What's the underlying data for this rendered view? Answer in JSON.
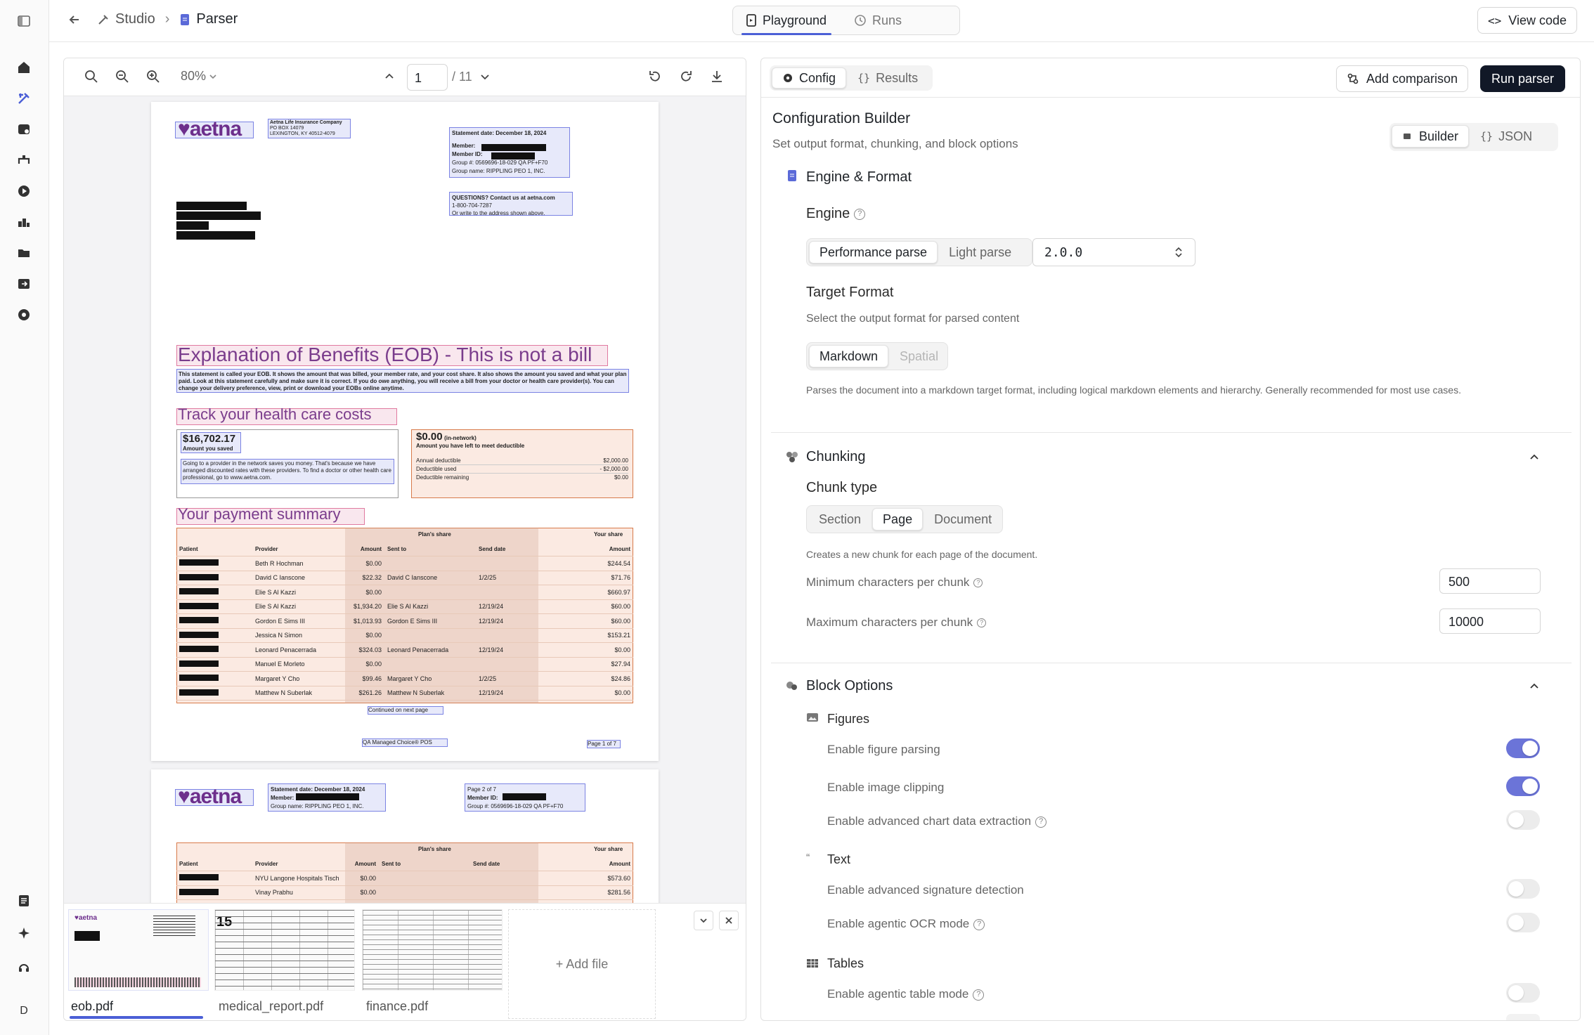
{
  "rail": {
    "avatar": "D"
  },
  "header": {
    "crumb_studio": "Studio",
    "crumb_parser": "Parser",
    "tab_playground": "Playground",
    "tab_runs": "Runs",
    "view_code": "View code"
  },
  "toolbar": {
    "zoom": "80%",
    "page_input": "1",
    "page_total": "/ 11"
  },
  "document": {
    "p1": {
      "logo": "♥aetna",
      "company": [
        "Aetna Life Insurance Company",
        "PO BOX 14079",
        "LEXINGTON, KY 40512-4079"
      ],
      "statement": "Statement date:  December 18, 2024",
      "member": "Member:",
      "member_id": "Member ID:",
      "group_num": "Group #:  0569696-18-029 QA PF+F70",
      "group_name": "Group name:  RIPPLING PEO 1, INC.",
      "questions": [
        "QUESTIONS? Contact us at aetna.com",
        "1-800-704-7287",
        "Or write to the address shown above."
      ],
      "title": "Explanation of Benefits (EOB) - This is not a bill",
      "intro": "This statement is called your EOB. It shows the amount that was billed, your member rate, and your cost share. It also shows the amount you saved and what your plan paid. Look at this statement carefully and make sure it is correct. If you do owe anything, you will receive a bill from your doctor or health care provider(s). You can change your delivery preference, view, print or download your EOBs online anytime.",
      "track": "Track your health care costs",
      "saved_amount": "$16,702.17",
      "saved_label": "Amount you saved",
      "saved_text": "Going to a provider in the network saves you money. That's because we have arranged discounted rates with these providers. To find a doctor or other health care professional, go to www.aetna.com.",
      "deduct_amount": "$0.00",
      "deduct_net": "(in-network)",
      "deduct_label": "Amount you have left to meet deductible",
      "annual_label": "Annual deductible",
      "annual_val": "$2,000.00",
      "used_label": "Deductible used",
      "used_val": "- $2,000.00",
      "remaining_label": "Deductible remaining",
      "remaining_val": "$0.00",
      "summary": "Your payment summary",
      "plans_share": "Plan's share",
      "your_share": "Your share",
      "cols": [
        "Patient",
        "Provider",
        "Amount",
        "Sent to",
        "Send date",
        "Amount"
      ],
      "rows": [
        [
          "Beth R Hochman",
          "$0.00",
          "",
          "",
          "$244.54"
        ],
        [
          "David C Ianscone",
          "$22.32",
          "David C Ianscone",
          "1/2/25",
          "$71.76"
        ],
        [
          "Elie S Al Kazzi",
          "$0.00",
          "",
          "",
          "$660.97"
        ],
        [
          "Elie S Al Kazzi",
          "$1,934.20",
          "Elie S Al Kazzi",
          "12/19/24",
          "$60.00"
        ],
        [
          "Gordon E Sims III",
          "$1,013.93",
          "Gordon E Sims III",
          "12/19/24",
          "$60.00"
        ],
        [
          "Jessica N Simon",
          "$0.00",
          "",
          "",
          "$153.21"
        ],
        [
          "Leonard Penacerrada",
          "$324.03",
          "Leonard Penacerrada",
          "12/19/24",
          "$0.00"
        ],
        [
          "Manuel E Morleto",
          "$0.00",
          "",
          "",
          "$27.94"
        ],
        [
          "Margaret Y Cho",
          "$99.46",
          "Margaret Y Cho",
          "1/2/25",
          "$24.86"
        ],
        [
          "Matthew N Suberlak",
          "$261.26",
          "Matthew N Suberlak",
          "12/19/24",
          "$0.00"
        ]
      ],
      "continued": "Continued on next page",
      "footer_left": "QA Managed Choice® POS",
      "footer_right": "Page 1 of 7"
    },
    "p2": {
      "logo": "♥aetna",
      "statement": "Statement date:  December 18, 2024",
      "member": "Member:",
      "group_name": "Group name:  RIPPLING PEO 1, INC.",
      "page": "Page 2 of 7",
      "member_id": "Member ID:",
      "group_num": "Group #:  0569696-18-029 QA PF+F70",
      "plans_share": "Plan's share",
      "your_share": "Your share",
      "cols": [
        "Patient",
        "Provider",
        "Amount",
        "Sent to",
        "Send date",
        "Amount"
      ],
      "rows": [
        [
          "NYU Langone Hospitals Tisch",
          "$0.00",
          "",
          "",
          "$573.60"
        ],
        [
          "Vinay Prabhu",
          "$0.00",
          "",
          "",
          "$281.56"
        ]
      ]
    }
  },
  "files": {
    "f1": "eob.pdf",
    "f2": "medical_report.pdf",
    "f3": "finance.pdf",
    "add": "+ Add file"
  },
  "config": {
    "tab_config": "Config",
    "tab_results": "Results",
    "add_comparison": "Add comparison",
    "run_parser": "Run parser",
    "title": "Configuration Builder",
    "subtitle": "Set output format, chunking, and block options",
    "mode_builder": "Builder",
    "mode_json": "JSON",
    "engine_section": "Engine & Format",
    "engine_label": "Engine",
    "engine_perf": "Performance parse",
    "engine_light": "Light parse",
    "engine_version": "2.0.0",
    "target_label": "Target Format",
    "target_sub": "Select the output format for parsed content",
    "fmt_markdown": "Markdown",
    "fmt_spatial": "Spatial",
    "target_desc": "Parses the document into a markdown target format, including logical markdown elements and hierarchy. Generally recommended for most use cases.",
    "chunking_section": "Chunking",
    "chunk_type": "Chunk type",
    "chunk_section": "Section",
    "chunk_page": "Page",
    "chunk_document": "Document",
    "chunk_desc": "Creates a new chunk for each page of the document.",
    "min_label": "Minimum characters per chunk",
    "min_val": "500",
    "max_label": "Maximum characters per chunk",
    "max_val": "10000",
    "block_section": "Block Options",
    "figures": "Figures",
    "fig_parse": "Enable figure parsing",
    "fig_clip": "Enable image clipping",
    "fig_chart": "Enable advanced chart data extraction",
    "text": "Text",
    "txt_sig": "Enable advanced signature detection",
    "txt_ocr": "Enable agentic OCR mode",
    "tables": "Tables",
    "tbl_agentic": "Enable agentic table mode"
  },
  "colors": {
    "accent": "#4b5fd6",
    "toggle_on": "#6b74d8",
    "dark_button": "#111827"
  }
}
